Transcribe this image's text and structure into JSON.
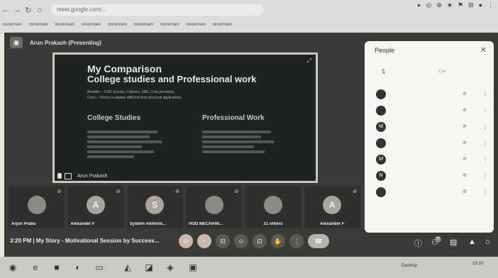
{
  "browser": {
    "url": "meet.google.com/...",
    "bookmarks": [
      "Bookmark",
      "Bookmark",
      "Bookmark",
      "Bookmark",
      "Bookmark",
      "Bookmark",
      "Bookmark",
      "Bookmark",
      "Bookmark",
      "Bookmark"
    ]
  },
  "meet": {
    "presenting_label": "Arun Prakash (Presenting)",
    "slide": {
      "title_line1": "My Comparison",
      "title_line2": "College studies and Professional work",
      "benefits": "Benefits – CAD, Events, Cultures, SAE, Core principles",
      "cons": "Cons – Theory is always different from practical applications",
      "col1_head": "College Studies",
      "col2_head": "Professional Work",
      "presenter": "Arun Prakash"
    },
    "tiles": [
      {
        "name": "Arjun Prabu",
        "avatar": ""
      },
      {
        "name": "Alexander F",
        "avatar": "A"
      },
      {
        "name": "System Adminis...",
        "avatar": "S"
      },
      {
        "name": "HOD MECHANI...",
        "avatar": ""
      },
      {
        "name": "21 others",
        "avatar": ""
      },
      {
        "name": "Alexander F",
        "avatar": "A"
      }
    ],
    "meeting_info": "3:20 PM | My Story - Motivational Session by Success...",
    "people_count": "27"
  },
  "panel": {
    "title": "People",
    "people": [
      {
        "initial": ""
      },
      {
        "initial": ""
      },
      {
        "initial": "M"
      },
      {
        "initial": ""
      },
      {
        "initial": "M"
      },
      {
        "initial": "N"
      },
      {
        "initial": ""
      }
    ]
  },
  "taskbar": {
    "tray": "Desktop",
    "time": "15:20"
  }
}
